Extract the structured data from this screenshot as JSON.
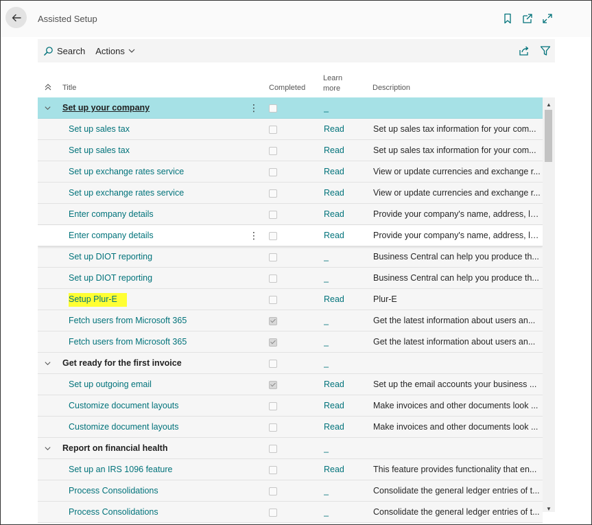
{
  "header": {
    "title": "Assisted Setup",
    "icons": [
      "back-arrow-icon",
      "bookmark-icon",
      "open-new-window-icon",
      "expand-icon"
    ]
  },
  "toolbar": {
    "search_label": "Search",
    "actions_label": "Actions",
    "right_icons": [
      "share-icon",
      "filter-icon"
    ]
  },
  "columns": {
    "title": "Title",
    "completed": "Completed",
    "learn_more": "Learn more",
    "learn_line1": "Learn",
    "learn_line2": "more",
    "description": "Description"
  },
  "rows": [
    {
      "type": "group",
      "title": "Set up your company",
      "completed": false,
      "learn": "_",
      "description": "",
      "selected": true
    },
    {
      "type": "item",
      "title": "Set up sales tax",
      "completed": false,
      "learn": "Read",
      "description": "Set up sales tax information for your com..."
    },
    {
      "type": "item",
      "title": "Set up sales tax",
      "completed": false,
      "learn": "Read",
      "description": "Set up sales tax information for your com..."
    },
    {
      "type": "item",
      "title": "Set up exchange rates service",
      "completed": false,
      "learn": "Read",
      "description": "View or update currencies and exchange r..."
    },
    {
      "type": "item",
      "title": "Set up exchange rates service",
      "completed": false,
      "learn": "Read",
      "description": "View or update currencies and exchange r..."
    },
    {
      "type": "item",
      "title": "Enter company details",
      "completed": false,
      "learn": "Read",
      "description": "Provide your company's name, address, lo..."
    },
    {
      "type": "item",
      "title": "Enter company details",
      "completed": false,
      "learn": "Read",
      "description": "Provide your company's name, address, lo...",
      "hover": true
    },
    {
      "type": "item",
      "title": "Set up DIOT reporting",
      "completed": false,
      "learn": "_",
      "description": "Business Central can help you produce th..."
    },
    {
      "type": "item",
      "title": "Set up DIOT reporting",
      "completed": false,
      "learn": "_",
      "description": "Business Central can help you produce th..."
    },
    {
      "type": "item",
      "title": "Setup Plur-E",
      "completed": false,
      "learn": "Read",
      "description": "Plur-E",
      "highlight": true
    },
    {
      "type": "item",
      "title": "Fetch users from Microsoft 365",
      "completed": true,
      "learn": "_",
      "description": "Get the latest information about users an..."
    },
    {
      "type": "item",
      "title": "Fetch users from Microsoft 365",
      "completed": true,
      "learn": "_",
      "description": "Get the latest information about users an..."
    },
    {
      "type": "group",
      "title": "Get ready for the first invoice",
      "completed": false,
      "learn": "_",
      "description": ""
    },
    {
      "type": "item",
      "title": "Set up outgoing email",
      "completed": true,
      "learn": "Read",
      "description": "Set up the email accounts your business ..."
    },
    {
      "type": "item",
      "title": "Customize document layouts",
      "completed": false,
      "learn": "Read",
      "description": "Make invoices and other documents look ..."
    },
    {
      "type": "item",
      "title": "Customize document layouts",
      "completed": false,
      "learn": "Read",
      "description": "Make invoices and other documents look ..."
    },
    {
      "type": "group",
      "title": "Report on financial health",
      "completed": false,
      "learn": "_",
      "description": ""
    },
    {
      "type": "item",
      "title": "Set up an IRS 1096 feature",
      "completed": false,
      "learn": "Read",
      "description": "This feature provides functionality that en..."
    },
    {
      "type": "item",
      "title": "Process Consolidations",
      "completed": false,
      "learn": "_",
      "description": "Consolidate the general ledger entries of t..."
    },
    {
      "type": "item",
      "title": "Process Consolidations",
      "completed": false,
      "learn": "_",
      "description": "Consolidate the general ledger entries of t..."
    }
  ],
  "colors": {
    "accent": "#00727a",
    "selected_row": "#a6e1e6",
    "highlight": "#ffff33"
  }
}
